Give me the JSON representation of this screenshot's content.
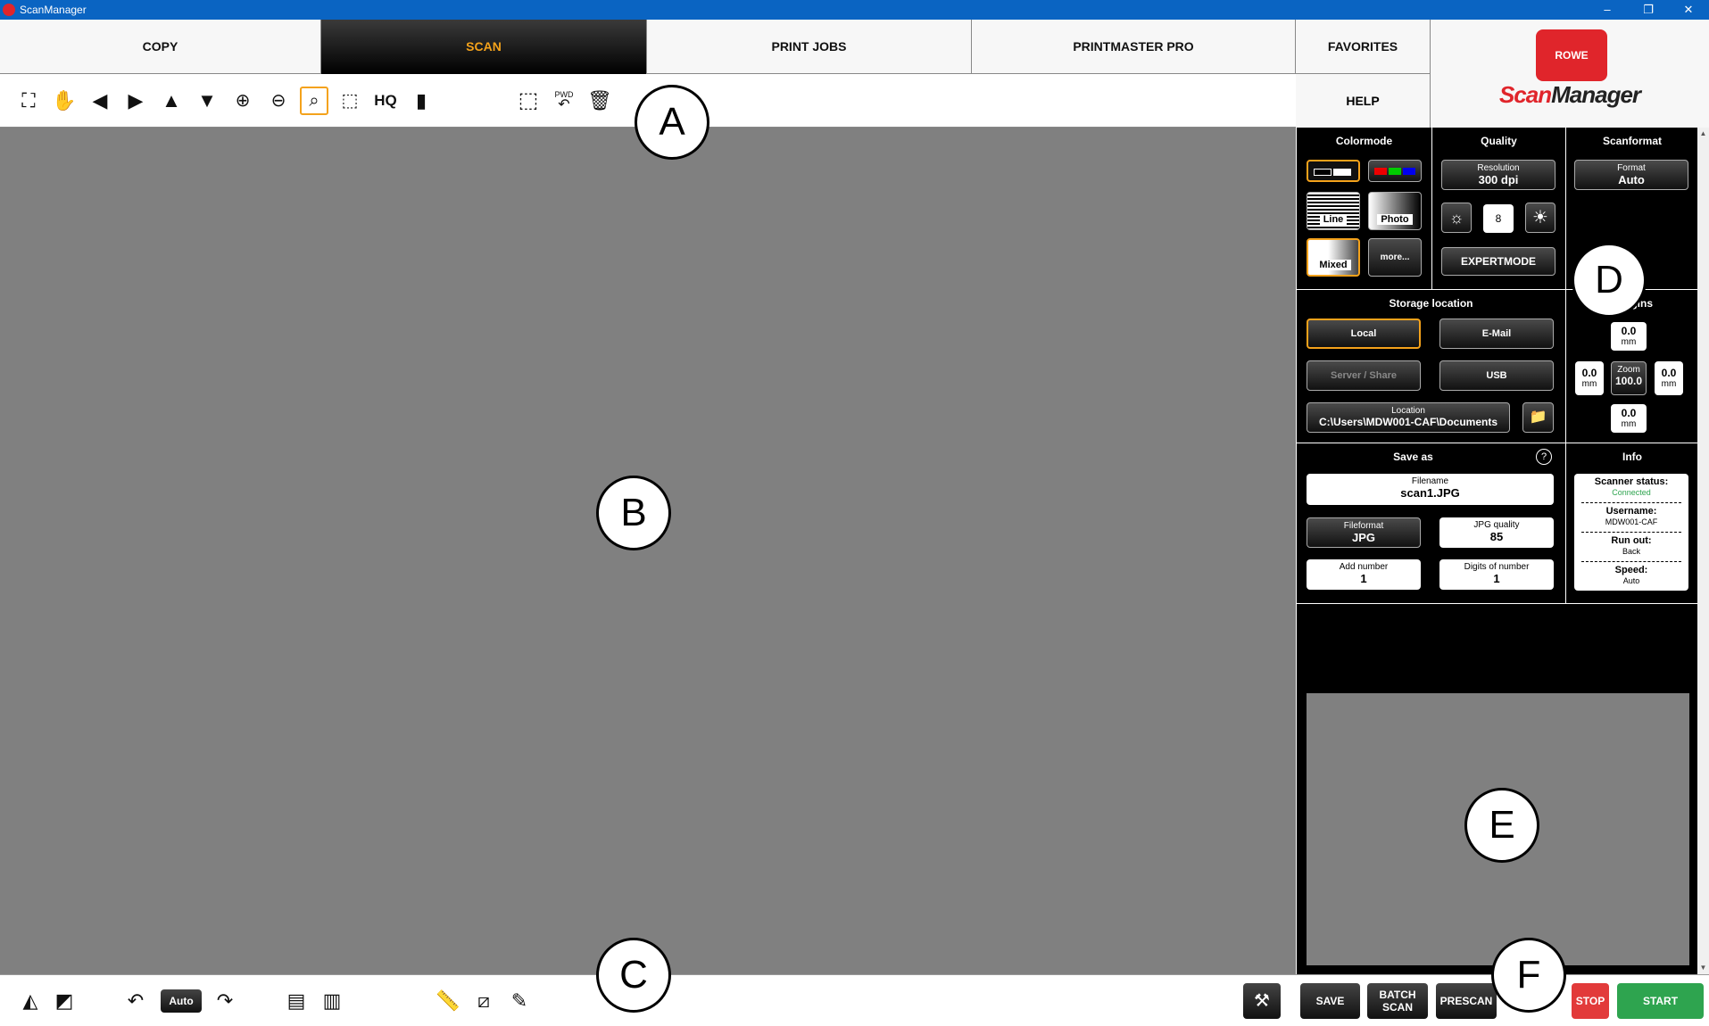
{
  "window": {
    "title": "ScanManager"
  },
  "tabs": [
    "COPY",
    "SCAN",
    "PRINT JOBS",
    "PRINTMASTER PRO",
    "FAVORITES"
  ],
  "help_label": "HELP",
  "logo": {
    "badge_text": "ROWE",
    "word_a": "Scan",
    "word_b": "Manager"
  },
  "toolbar": {
    "hq_label": "HQ",
    "pwd_label": "PWD"
  },
  "bottom": {
    "auto_label": "Auto",
    "save_label": "SAVE",
    "batch_label_1": "BATCH",
    "batch_label_2": "SCAN",
    "prescan_label": "PRESCAN",
    "stop_label": "STOP",
    "start_label": "START"
  },
  "panel": {
    "colormode": {
      "title": "Colormode",
      "line": "Line",
      "photo": "Photo",
      "mixed": "Mixed",
      "more": "more..."
    },
    "quality": {
      "title": "Quality",
      "resolution_label": "Resolution",
      "resolution_value": "300 dpi",
      "brightness": "8",
      "expertmode": "EXPERTMODE"
    },
    "scanformat": {
      "title": "Scanformat",
      "format_label": "Format",
      "format_value": "Auto"
    },
    "storage": {
      "title": "Storage location",
      "local": "Local",
      "email": "E-Mail",
      "server": "Server / Share",
      "usb": "USB",
      "location_label": "Location",
      "location_value": "C:\\Users\\MDW001-CAF\\Documents"
    },
    "margins": {
      "title": "Margins",
      "top": "0.0",
      "left": "0.0",
      "right": "0.0",
      "bottom": "0.0",
      "unit": "mm",
      "zoom_label": "Zoom",
      "zoom_value": "100.0"
    },
    "saveas": {
      "title": "Save as",
      "help": "?",
      "filename_label": "Filename",
      "filename_value": "scan1.JPG",
      "fileformat_label": "Fileformat",
      "fileformat_value": "JPG",
      "jpgq_label": "JPG quality",
      "jpgq_value": "85",
      "addnum_label": "Add number",
      "addnum_value": "1",
      "digits_label": "Digits of number",
      "digits_value": "1"
    },
    "info": {
      "title": "Info",
      "scanner_label": "Scanner status:",
      "scanner_value": "Connected",
      "username_label": "Username:",
      "username_value": "MDW001-CAF",
      "runout_label": "Run out:",
      "runout_value": "Back",
      "speed_label": "Speed:",
      "speed_value": "Auto"
    }
  },
  "markers": {
    "a": "A",
    "b": "B",
    "c": "C",
    "d": "D",
    "e": "E",
    "f": "F"
  },
  "colors": {
    "accent": "#f4a21b",
    "start": "#2ea44f",
    "stop": "#e23a3a",
    "titlebar": "#0a64c2",
    "brand": "#e0252b"
  }
}
